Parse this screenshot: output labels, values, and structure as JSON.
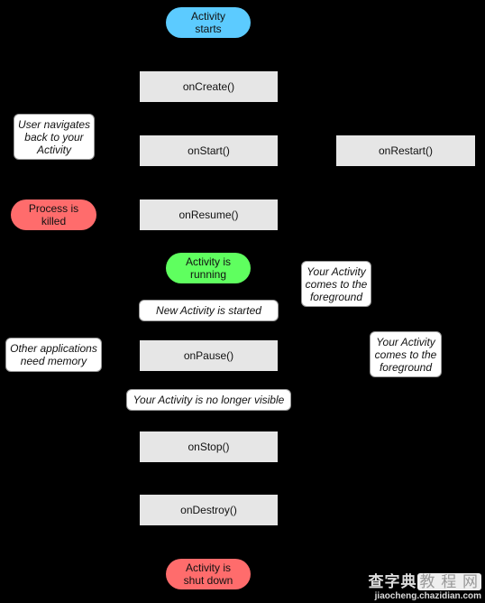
{
  "colors": {
    "start": "#5ccbff",
    "running": "#5fff5f",
    "killed": "#ff6c6c",
    "method": "#e6e6e6",
    "note": "#ffffff",
    "background": "#000000"
  },
  "nodes": {
    "activity_starts": "Activity\nstarts",
    "on_create": "onCreate()",
    "user_navigates": "User navigates\nback to your\nActivity",
    "on_start": "onStart()",
    "on_restart": "onRestart()",
    "process_killed": "Process is\nkilled",
    "on_resume": "onResume()",
    "activity_running": "Activity is\nrunning",
    "foreground_1": "Your Activity\ncomes to the\nforeground",
    "new_activity": "New Activity is started",
    "other_apps": "Other applications\nneed memory",
    "on_pause": "onPause()",
    "foreground_2": "Your Activity\ncomes to the\nforeground",
    "no_longer_visible": "Your Activity is no longer visible",
    "on_stop": "onStop()",
    "on_destroy": "onDestroy()",
    "shut_down": "Activity is\nshut down"
  },
  "watermark": {
    "top_main": "查字典",
    "top_sub": "教 程 网",
    "bottom": "jiaocheng.chazidian.com"
  }
}
